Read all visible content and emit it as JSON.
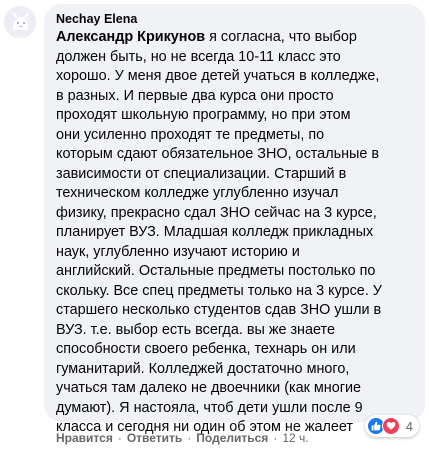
{
  "comment": {
    "author": "Nechay Elena",
    "mention": "Александр Крикунов",
    "lines": [
      " я согласна, что выбор",
      "должен быть, но не всегда 10-11 класс это",
      "хорошо. У меня двое детей учаться в колледже,",
      "в разных. И первые два курса они просто",
      "проходят школьную программу, но при этом",
      "они усиленно проходят те предметы, по",
      "которым сдают обязательное ЗНО, остальные в",
      "зависимости от специализации. Старший в",
      "техническом колледже углубленно изучал",
      "физику, прекрасно сдал ЗНО сейчас на 3 курсе,",
      "планирует ВУЗ. Младшая колледж прикладных",
      "наук, углубленно изучают историю и",
      "английский. Остальные предметы постолько по",
      "скольку. Все спец предметы только на 3 курсе. У",
      "старшего несколько студентов сдав ЗНО ушли в",
      "ВУЗ. т.е. выбор есть всегда. вы же знаете",
      "способности своего ребенка, технарь он или",
      "гуманитарий. Колледжей достаточно много,",
      "учаться там далеко не двоечники (как многие",
      "думают). Я настояла, чтоб дети ушли после 9",
      "класса и сегодня ни один об этом не жалеет"
    ],
    "reactions": {
      "count": "4",
      "icons": [
        "like-icon",
        "love-icon"
      ]
    },
    "actions": {
      "like": "Нравится",
      "reply": "Ответить",
      "share": "Поделиться",
      "time": "12 ч.",
      "separator": "·"
    }
  },
  "colors": {
    "bubble": "#f0f2f5",
    "text": "#050505",
    "secondary": "#65676b",
    "like": "#1877f2",
    "love": "#f33e58"
  }
}
